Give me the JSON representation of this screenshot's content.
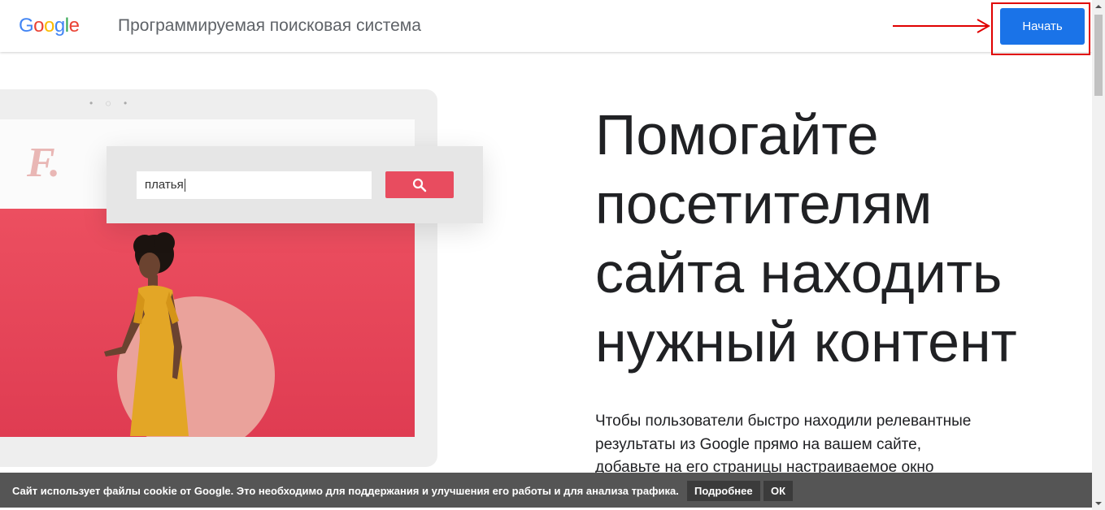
{
  "header": {
    "logo_letters": [
      {
        "char": "G",
        "color": "#4285F4"
      },
      {
        "char": "o",
        "color": "#EA4335"
      },
      {
        "char": "o",
        "color": "#FBBC05"
      },
      {
        "char": "g",
        "color": "#4285F4"
      },
      {
        "char": "l",
        "color": "#34A853"
      },
      {
        "char": "e",
        "color": "#EA4335"
      }
    ],
    "product_title": "Программируемая поисковая система",
    "start_button": "Начать",
    "accent_color": "#1a73e8",
    "annotation_color": "#e00000"
  },
  "illustration": {
    "site_logo": "F.",
    "search_query": "платья",
    "search_icon": "search-icon"
  },
  "hero": {
    "lines": [
      "Помогайте",
      "посетителям",
      "сайта находить",
      "нужный контент"
    ]
  },
  "description": {
    "lines": [
      "Чтобы пользователи быстро находили релевантные",
      "результаты из Google прямо на вашем сайте,",
      "добавьте на его страницы настраиваемое окно"
    ]
  },
  "cookie_bar": {
    "text": "Сайт использует файлы cookie от Google. Это необходимо для поддержания и улучшения его работы и для анализа трафика.",
    "more_button": "Подробнее",
    "ok_button": "ОК"
  }
}
